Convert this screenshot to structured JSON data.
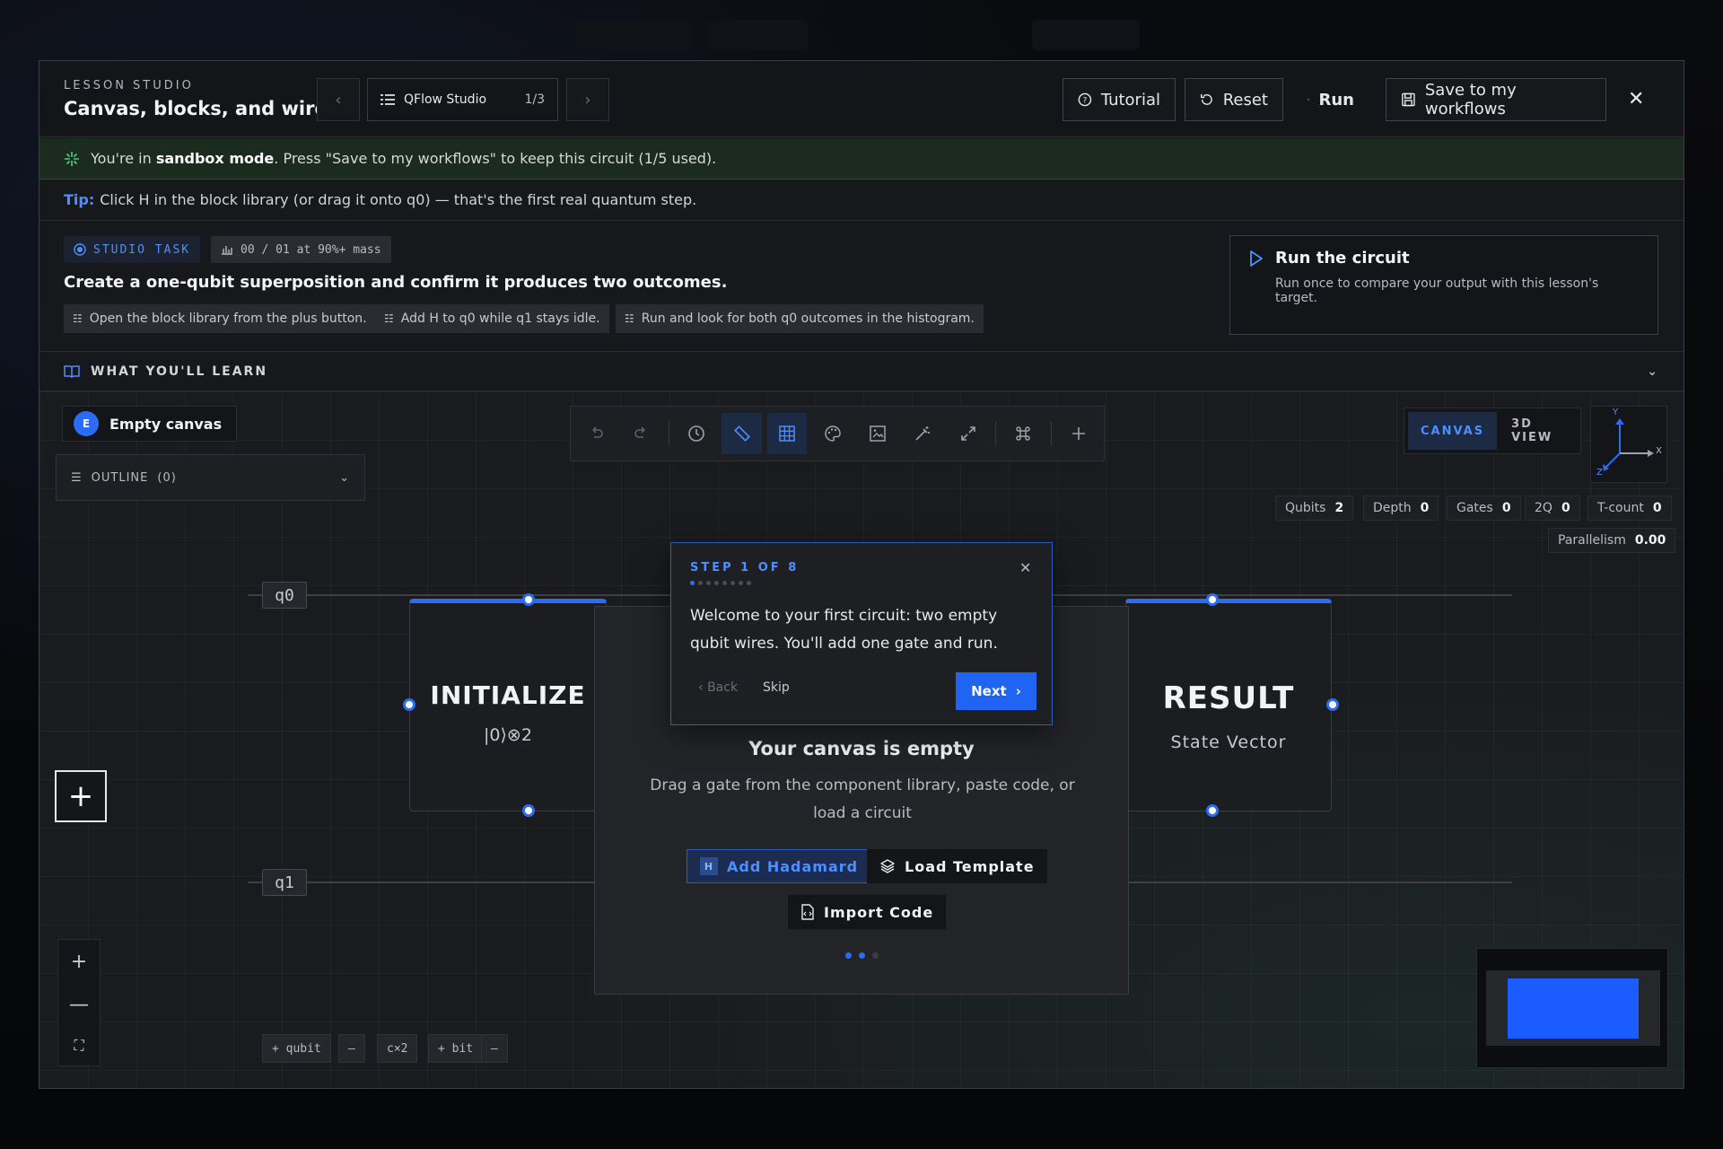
{
  "header": {
    "kicker": "LESSON STUDIO",
    "title": "Canvas, blocks, and wires",
    "studio_name": "QFlow Studio",
    "studio_progress": "1/3",
    "tutorial_label": "Tutorial",
    "reset_label": "Reset",
    "run_label": "Run",
    "save_label": "Save to my workflows"
  },
  "sandbox": {
    "prefix": "You're in",
    "mode": "sandbox mode",
    "suffix": ". Press \"Save to my workflows\" to keep this circuit (1/5 used)."
  },
  "tip": {
    "label": "Tip:",
    "text": "Click H in the block library (or drag it onto q0) — that's the first real quantum step."
  },
  "task": {
    "badge": "STUDIO TASK",
    "metric": "00 / 01 at 90%+ mass",
    "question": "Create a one-qubit superposition and confirm it produces two outcomes.",
    "steps": [
      "Open the block library from the plus button.",
      "Add H to q0 while q1 stays idle.",
      "Run and look for both q0 outcomes in the histogram."
    ],
    "run_card_title": "Run the circuit",
    "run_card_desc": "Run once to compare your output with this lesson's target."
  },
  "learn": {
    "label": "WHAT YOU'LL LEARN"
  },
  "canvas": {
    "workspace_avatar": "E",
    "workspace_name": "Empty canvas",
    "outline_label": "OUTLINE",
    "outline_count": "(0)",
    "view_tabs": [
      "CANVAS",
      "3D VIEW"
    ],
    "axes": {
      "x": "X",
      "y": "Y",
      "z": "Z"
    },
    "stats": [
      {
        "label": "Qubits",
        "value": "2"
      },
      {
        "label": "Depth",
        "value": "0"
      },
      {
        "label": "Gates",
        "value": "0"
      },
      {
        "label": "2Q",
        "value": "0"
      },
      {
        "label": "T-count",
        "value": "0"
      }
    ],
    "parallelism_label": "Parallelism",
    "parallelism_value": "0.00",
    "qubits": [
      "q0",
      "q1"
    ],
    "init_block": {
      "title": "INITIALIZE",
      "subtitle": "|0⟩⊗2"
    },
    "result_block": {
      "title": "RESULT",
      "subtitle": "State Vector"
    },
    "empty_title": "Your canvas is empty",
    "empty_desc": "Drag a gate from the component library, paste code, or load a circuit",
    "add_hadamard": "Add Hadamard",
    "hadamard_badge": "H",
    "load_template": "Load Template",
    "import_code": "Import Code",
    "qubit_controls": [
      "+ qubit",
      "—",
      "c×2",
      "+ bit",
      "—"
    ]
  },
  "tour": {
    "step": "STEP 1 OF 8",
    "total_steps": 8,
    "current_step": 1,
    "text": "Welcome to your first circuit: two empty qubit wires. You'll add one gate and run.",
    "back": "Back",
    "skip": "Skip",
    "next": "Next"
  },
  "colors": {
    "accent": "#2b6cf5",
    "sandbox_bg": "#1c2b20",
    "panel": "#17181c"
  }
}
